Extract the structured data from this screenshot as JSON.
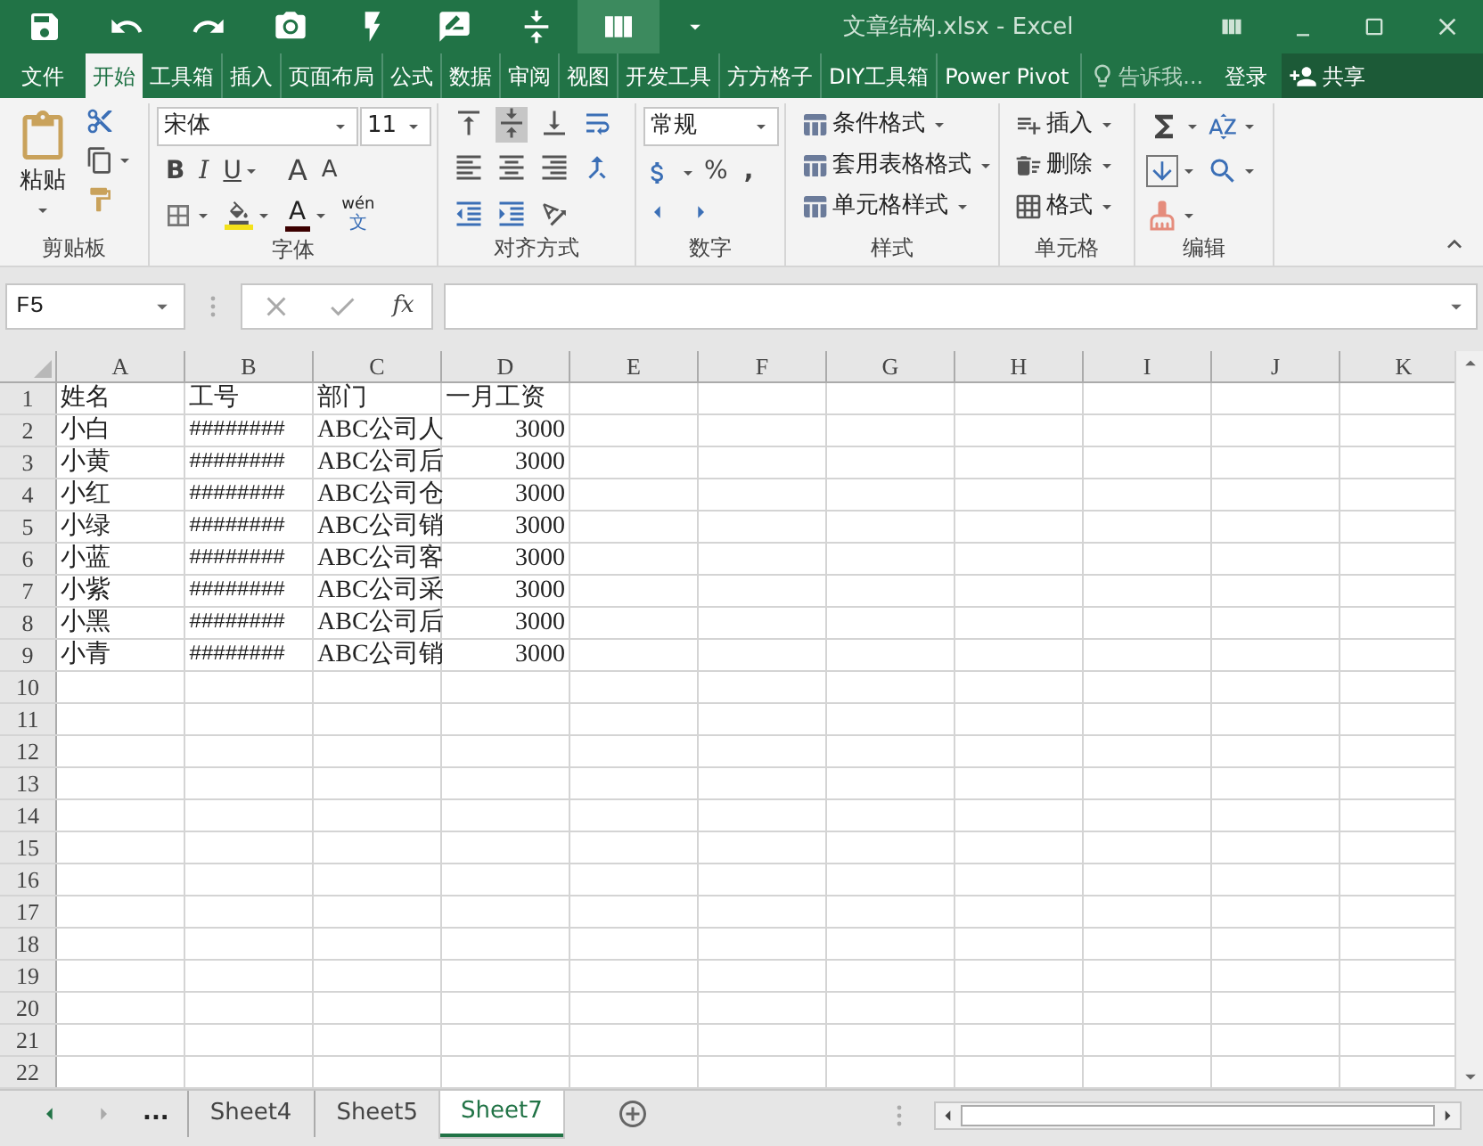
{
  "window": {
    "title": "文章结构.xlsx - Excel"
  },
  "quick_access": [
    {
      "kind": "save",
      "highlighted": false
    },
    {
      "kind": "undo",
      "highlighted": false
    },
    {
      "kind": "redo",
      "highlighted": false
    },
    {
      "kind": "camera",
      "highlighted": false
    },
    {
      "kind": "flash",
      "highlighted": false
    },
    {
      "kind": "comment",
      "highlighted": false
    },
    {
      "kind": "distribute",
      "highlighted": false
    },
    {
      "kind": "columns",
      "highlighted": true
    },
    {
      "kind": "customize",
      "highlighted": false
    }
  ],
  "ribbon_tabs": [
    {
      "label": "文件",
      "selected": false
    },
    {
      "label": "开始",
      "selected": true
    },
    {
      "label": "工具箱",
      "selected": false
    },
    {
      "label": "插入",
      "selected": false
    },
    {
      "label": "页面布局",
      "selected": false
    },
    {
      "label": "公式",
      "selected": false
    },
    {
      "label": "数据",
      "selected": false
    },
    {
      "label": "审阅",
      "selected": false
    },
    {
      "label": "视图",
      "selected": false
    },
    {
      "label": "开发工具",
      "selected": false
    },
    {
      "label": "方方格子",
      "selected": false
    },
    {
      "label": "DIY工具箱",
      "selected": false
    },
    {
      "label": "Power Pivot",
      "selected": false
    }
  ],
  "tell_me": {
    "placeholder": "告诉我..."
  },
  "sign_in": "登录",
  "share": "共享",
  "clipboard": {
    "label": "剪贴板",
    "paste": "粘贴"
  },
  "font": {
    "label": "字体",
    "font_name": "宋体",
    "font_size": "11",
    "bold": "B",
    "italic": "I",
    "underline": "U",
    "grow": "A",
    "shrink": "A",
    "font_color": "A",
    "phonetic_top": "wén",
    "phonetic_bottom": "文"
  },
  "alignment": {
    "label": "对齐方式"
  },
  "number": {
    "label": "数字",
    "format": "常规",
    "percent": "%",
    "comma": ","
  },
  "styles": {
    "label": "样式",
    "items": [
      "条件格式",
      "套用表格格式",
      "单元格样式"
    ]
  },
  "cells": {
    "label": "单元格",
    "items": [
      "插入",
      "删除",
      "格式"
    ]
  },
  "editing": {
    "label": "编辑"
  },
  "formula_bar": {
    "name_box": "F5",
    "fx": "fx"
  },
  "table": {
    "columns": [
      "A",
      "B",
      "C",
      "D",
      "E",
      "F",
      "G",
      "H",
      "I",
      "J",
      "K"
    ],
    "rows": [
      {
        "number": "1",
        "cells": [
          "姓名",
          "工号",
          "部门",
          "一月工资"
        ]
      },
      {
        "number": "2",
        "cells": [
          "小白",
          "########",
          "ABC公司人",
          "3000"
        ]
      },
      {
        "number": "3",
        "cells": [
          "小黄",
          "########",
          "ABC公司后",
          "3000"
        ]
      },
      {
        "number": "4",
        "cells": [
          "小红",
          "########",
          "ABC公司仓",
          "3000"
        ]
      },
      {
        "number": "5",
        "cells": [
          "小绿",
          "########",
          "ABC公司销",
          "3000"
        ]
      },
      {
        "number": "6",
        "cells": [
          "小蓝",
          "########",
          "ABC公司客",
          "3000"
        ]
      },
      {
        "number": "7",
        "cells": [
          "小紫",
          "########",
          "ABC公司采",
          "3000"
        ]
      },
      {
        "number": "8",
        "cells": [
          "小黑",
          "########",
          "ABC公司后",
          "3000"
        ]
      },
      {
        "number": "9",
        "cells": [
          "小青",
          "########",
          "ABC公司销",
          "3000"
        ]
      },
      {
        "number": "10",
        "cells": []
      },
      {
        "number": "11",
        "cells": []
      },
      {
        "number": "12",
        "cells": []
      },
      {
        "number": "13",
        "cells": []
      },
      {
        "number": "14",
        "cells": []
      },
      {
        "number": "15",
        "cells": []
      },
      {
        "number": "16",
        "cells": []
      },
      {
        "number": "17",
        "cells": []
      },
      {
        "number": "18",
        "cells": []
      },
      {
        "number": "19",
        "cells": []
      },
      {
        "number": "20",
        "cells": []
      },
      {
        "number": "21",
        "cells": []
      },
      {
        "number": "22",
        "cells": []
      }
    ]
  },
  "sheet_nav": "...",
  "sheets": [
    {
      "label": "Sheet4",
      "selected": false
    },
    {
      "label": "Sheet5",
      "selected": false
    },
    {
      "label": "Sheet7",
      "selected": true
    }
  ]
}
